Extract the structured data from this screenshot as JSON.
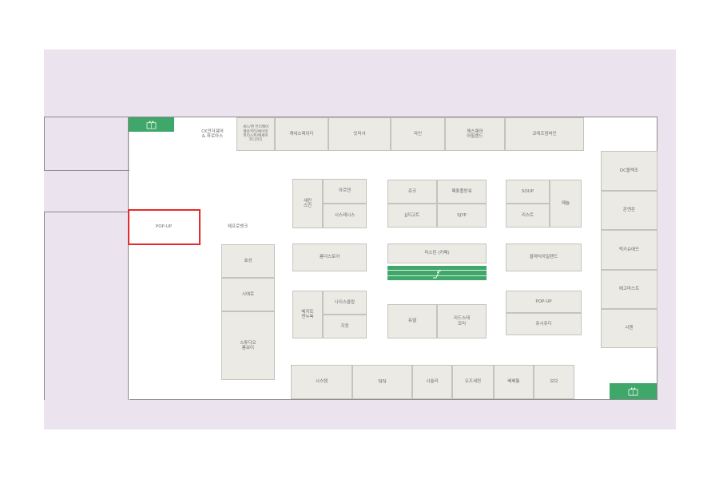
{
  "map": {
    "stores": {
      "ck_underwear": "CK언더웨어\n& 파로마스",
      "stack_store": "게스/켄 언더웨어\n헬로키티/에이잇\n파리스트/에세이\n코디코디",
      "keneth_lady": "케네스레이디",
      "inmaesa": "잇미샤",
      "lain": "라인",
      "chess_wear": "체스웨어\n어필랜드",
      "codes_combine": "코데즈컴바인",
      "dc_black": "DC블랙조",
      "sechan_skin": "세컨\n스킨",
      "arden": "아르덴",
      "sisley": "시스레시스",
      "juke": "쥬크",
      "pepper": "패롯플랑워",
      "jj": "JJ지고트",
      "sjyp": "SJYP",
      "soup": "SOUP",
      "liest": "리스트",
      "mabel": "매뉼",
      "onandon": "온앤온",
      "popup_left": "POP-UP",
      "eflowbank": "에프로뱅크",
      "ilsang": "효성",
      "sieno": "시에로",
      "studio_tomboy": "스튜디오\n톰보이",
      "roemstore": "롬더스토어",
      "mistin_cafe": "미스틴 (카페)",
      "classic_island": "클래식아일랜드",
      "tuckshop": "럭키슈에뜨",
      "popup_right": "POP-UP",
      "tissyoody": "쥬시쥬디",
      "magforest": "애고마스트",
      "becky_stone": "베지트\n앤누욕",
      "nice_claup": "나이스클랍",
      "zipper": "지컷",
      "duel": "듀엘",
      "lindcross": "리드스테\n모리",
      "sahen": "사헨",
      "system": "시스템",
      "sjsj": "SJSJ",
      "shulin": "시슬리",
      "ozsecon": "오즈세컨",
      "bebebong": "베베통",
      "bobo": "보브"
    },
    "facilities": {
      "top_icon": "restroom-icon",
      "bottom_icon": "restroom-icon"
    },
    "colors": {
      "background": "#ebe3ed",
      "store_fill": "#ebeae5",
      "facility": "#3fa76a",
      "highlight": "#e52b2b"
    },
    "highlighted_store": "popup_left"
  }
}
